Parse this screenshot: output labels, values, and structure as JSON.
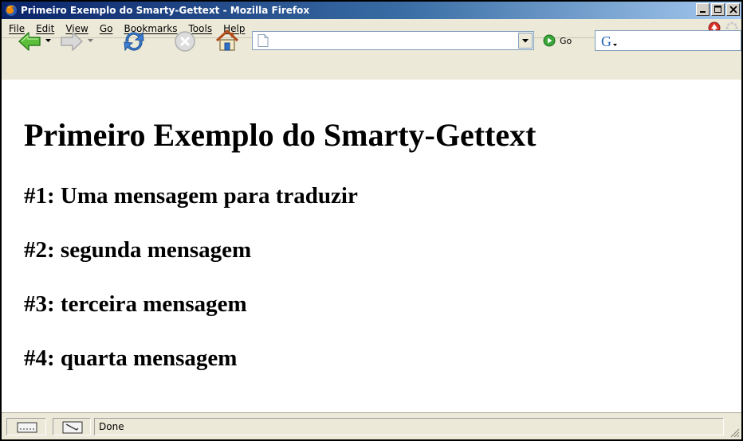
{
  "window": {
    "title": "Primeiro Exemplo do Smarty-Gettext - Mozilla Firefox",
    "app_icon": "firefox-icon",
    "caption_buttons": [
      "minimize-icon",
      "maximize-icon",
      "close-icon"
    ]
  },
  "menubar": {
    "items": [
      {
        "label": "File"
      },
      {
        "label": "Edit"
      },
      {
        "label": "View"
      },
      {
        "label": "Go"
      },
      {
        "label": "Bookmarks"
      },
      {
        "label": "Tools"
      },
      {
        "label": "Help"
      }
    ],
    "right_icons": [
      "update-alert-icon",
      "throbber-icon"
    ]
  },
  "toolbar": {
    "buttons": [
      "back-icon",
      "forward-icon",
      "reload-icon",
      "stop-icon",
      "home-icon"
    ],
    "address": {
      "value": "",
      "placeholder": ""
    },
    "go_label": "Go",
    "search": {
      "value": "",
      "engine_icon": "google-icon"
    }
  },
  "page": {
    "heading": "Primeiro Exemplo do Smarty-Gettext",
    "messages": [
      "#1: Uma mensagem para traduzir",
      "#2: segunda mensagem",
      "#3: terceira mensagem",
      "#4: quarta mensagem"
    ]
  },
  "statusbar": {
    "text": "Done"
  },
  "colors": {
    "titlebar_start": "#0a246a",
    "titlebar_end": "#a6caf0",
    "chrome": "#ece9d8"
  }
}
